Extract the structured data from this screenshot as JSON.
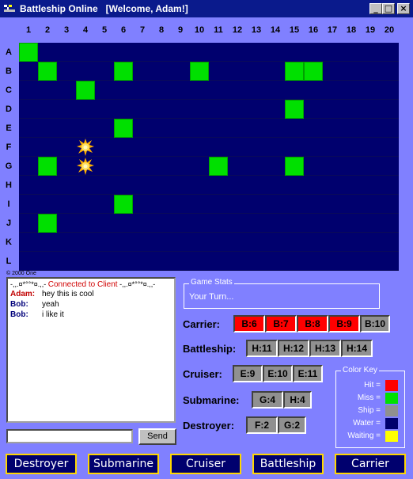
{
  "window": {
    "title": "Battleship Online   [Welcome, Adam!]",
    "controls": {
      "minimize": "_",
      "maximize": "□",
      "close": "×"
    }
  },
  "board": {
    "columns": [
      "1",
      "2",
      "3",
      "4",
      "5",
      "6",
      "7",
      "8",
      "9",
      "10",
      "11",
      "12",
      "13",
      "14",
      "15",
      "16",
      "17",
      "18",
      "19",
      "20"
    ],
    "rows": [
      "A",
      "B",
      "C",
      "D",
      "E",
      "F",
      "G",
      "H",
      "I",
      "J",
      "K",
      "L"
    ],
    "ship_cells": [
      {
        "row": "A",
        "col": 1
      },
      {
        "row": "B",
        "col": 2
      },
      {
        "row": "B",
        "col": 6
      },
      {
        "row": "B",
        "col": 10
      },
      {
        "row": "B",
        "col": 15
      },
      {
        "row": "B",
        "col": 16
      },
      {
        "row": "C",
        "col": 4
      },
      {
        "row": "D",
        "col": 15
      },
      {
        "row": "E",
        "col": 6
      },
      {
        "row": "G",
        "col": 2
      },
      {
        "row": "G",
        "col": 11
      },
      {
        "row": "G",
        "col": 15
      },
      {
        "row": "I",
        "col": 6
      },
      {
        "row": "J",
        "col": 2
      }
    ],
    "explosions": [
      {
        "row": "F",
        "col": 4
      },
      {
        "row": "G",
        "col": 4
      }
    ],
    "copyright": "© 2000 One"
  },
  "chat": {
    "system_prefix": "-,,.¤*°°*¤.,,-",
    "system_message": "Connected to Client",
    "system_suffix": "-,,.¤*°°*¤.,,-",
    "messages": [
      {
        "nick": "Adam:",
        "text": "hey this is cool",
        "color": "#c00000"
      },
      {
        "nick": "Bob:",
        "text": "yeah",
        "color": "#00007a"
      },
      {
        "nick": "Bob:",
        "text": "i like it",
        "color": "#00007a"
      }
    ],
    "input_value": "",
    "send_label": "Send"
  },
  "stats": {
    "legend": "Game Stats",
    "status": "Your Turn..."
  },
  "fleet": [
    {
      "name": "Carrier:",
      "segments": [
        {
          "label": "B:6",
          "state": "hit"
        },
        {
          "label": "B:7",
          "state": "hit"
        },
        {
          "label": "B:8",
          "state": "hit"
        },
        {
          "label": "B:9",
          "state": "hit"
        },
        {
          "label": "B:10",
          "state": "ship"
        }
      ]
    },
    {
      "name": "Battleship:",
      "segments": [
        {
          "label": "H:11",
          "state": "ship"
        },
        {
          "label": "H:12",
          "state": "ship"
        },
        {
          "label": "H:13",
          "state": "ship"
        },
        {
          "label": "H:14",
          "state": "ship"
        }
      ]
    },
    {
      "name": "Cruiser:",
      "segments": [
        {
          "label": "E:9",
          "state": "ship"
        },
        {
          "label": "E:10",
          "state": "ship"
        },
        {
          "label": "E:11",
          "state": "ship"
        }
      ]
    },
    {
      "name": "Submarine:",
      "segments": [
        {
          "label": "G:4",
          "state": "ship"
        },
        {
          "label": "H:4",
          "state": "ship"
        }
      ]
    },
    {
      "name": "Destroyer:",
      "segments": [
        {
          "label": "F:2",
          "state": "ship"
        },
        {
          "label": "G:2",
          "state": "ship"
        }
      ]
    }
  ],
  "color_key": {
    "legend": "Color Key",
    "entries": [
      {
        "label": "Hit =",
        "color": "#ff0000"
      },
      {
        "label": "Miss =",
        "color": "#00e000"
      },
      {
        "label": "Ship =",
        "color": "#909090"
      },
      {
        "label": "Water =",
        "color": "#00006e"
      },
      {
        "label": "Waiting =",
        "color": "#ffff00"
      }
    ]
  },
  "ship_buttons": [
    "Destroyer",
    "Submarine",
    "Cruiser",
    "Battleship",
    "Carrier"
  ],
  "colors": {
    "background": "#8080ff",
    "water": "#00006e",
    "miss": "#00e000",
    "hit": "#ff0000",
    "ship": "#909090",
    "titlebar": "#0a1a8c",
    "button_border": "#ffd700"
  }
}
